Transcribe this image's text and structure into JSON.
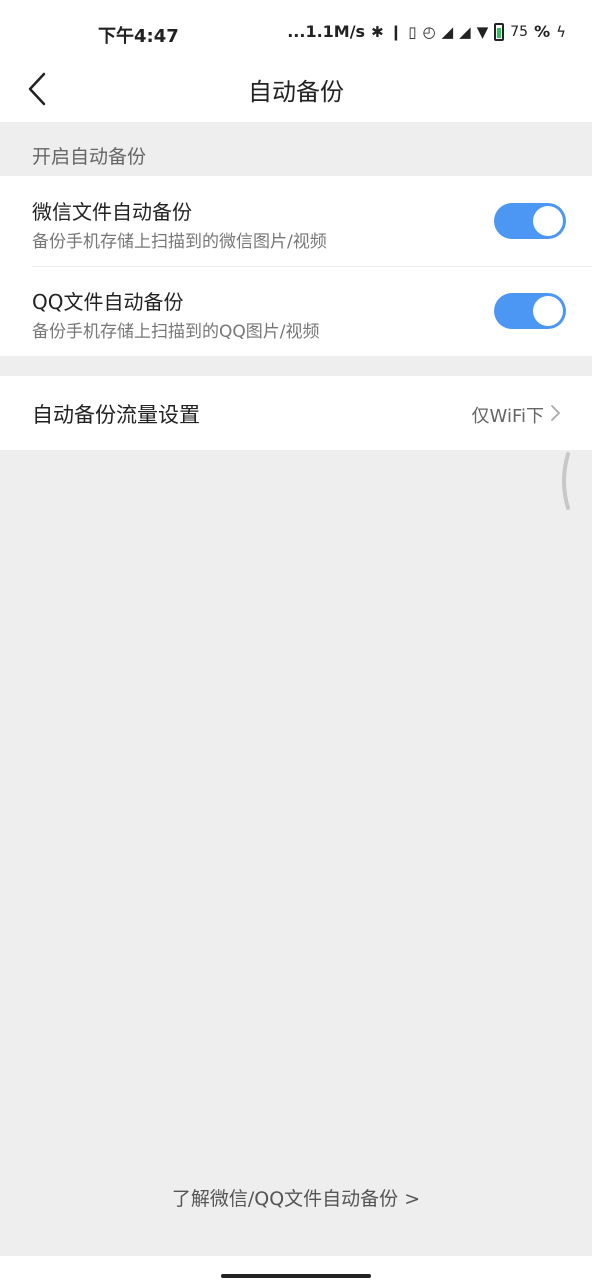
{
  "status_bar": {
    "time": "下午4:47",
    "network_speed": "...1.1M/s",
    "battery_percent": "75",
    "percent_sign": "%",
    "icons": [
      "bluetooth-icon",
      "nfc-icon",
      "vibrate-icon",
      "alarm-icon",
      "hd-signal-icon",
      "signal-icon",
      "wifi-icon",
      "battery-icon",
      "charging-icon"
    ]
  },
  "header": {
    "title": "自动备份",
    "back_icon": "back-chevron-icon"
  },
  "section": {
    "label": "开启自动备份"
  },
  "toggles": [
    {
      "title": "微信文件自动备份",
      "subtitle": "备份手机存储上扫描到的微信图片/视频",
      "enabled": true
    },
    {
      "title": "QQ文件自动备份",
      "subtitle": "备份手机存储上扫描到的QQ图片/视频",
      "enabled": true
    }
  ],
  "traffic": {
    "label": "自动备份流量设置",
    "value": "仅WiFi下"
  },
  "footer": {
    "link_text": "了解微信/QQ文件自动备份 >"
  },
  "colors": {
    "toggle_on": "#4d97f4",
    "background": "#eeeeee",
    "card": "#ffffff"
  }
}
